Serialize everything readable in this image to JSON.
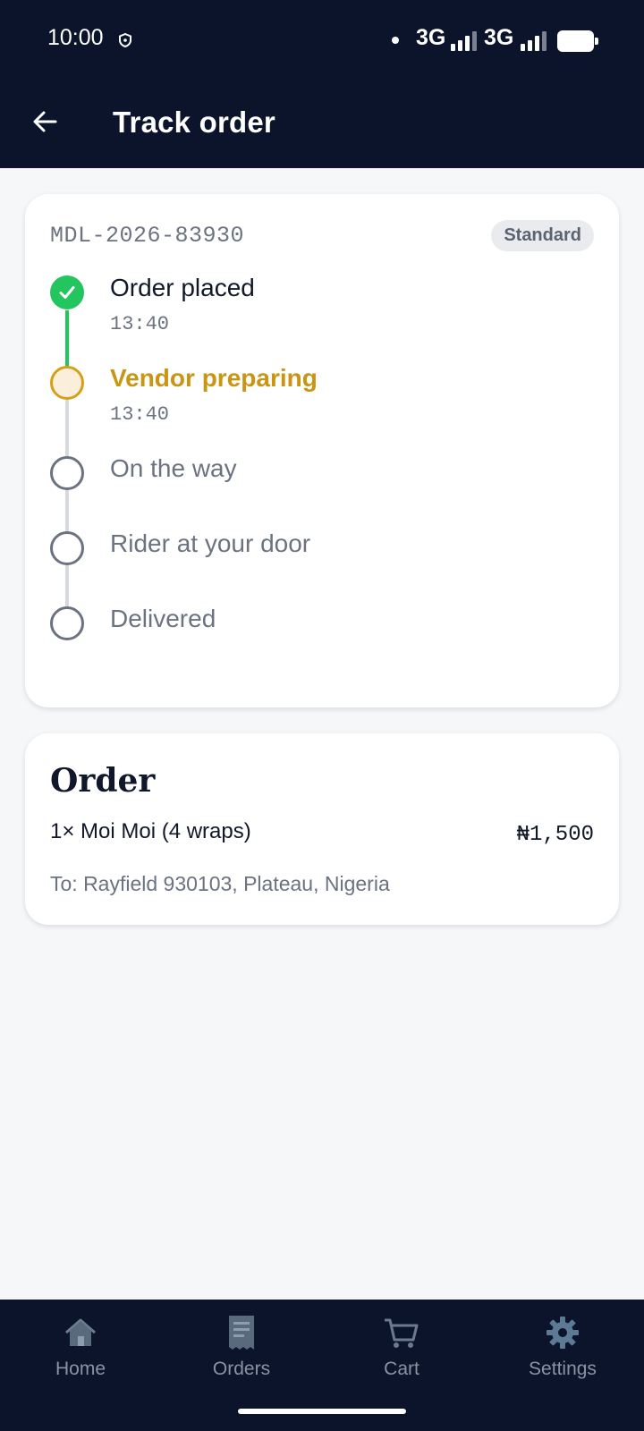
{
  "status_bar": {
    "time": "10:00",
    "network_1": "3G",
    "network_2": "3G",
    "icons": [
      "shield-icon",
      "dot-icon",
      "signal-icon",
      "signal-icon",
      "battery-icon"
    ]
  },
  "app_bar": {
    "title": "Track order",
    "back_icon": "arrow-left-icon"
  },
  "tracking": {
    "order_id": "MDL-2026-83930",
    "tier": "Standard",
    "steps": [
      {
        "label": "Order placed",
        "time": "13:40",
        "state": "done"
      },
      {
        "label": "Vendor preparing",
        "time": "13:40",
        "state": "active"
      },
      {
        "label": "On the way",
        "state": "todo"
      },
      {
        "label": "Rider at your door",
        "state": "todo"
      },
      {
        "label": "Delivered",
        "state": "todo"
      }
    ]
  },
  "order": {
    "heading": "Order",
    "item": "1× Moi Moi (4 wraps)",
    "price": "₦1,500",
    "address": "To: Rayfield 930103, Plateau, Nigeria"
  },
  "bottom_nav": {
    "items": [
      {
        "label": "Home",
        "icon": "home-icon"
      },
      {
        "label": "Orders",
        "icon": "receipt-icon"
      },
      {
        "label": "Cart",
        "icon": "cart-icon"
      },
      {
        "label": "Settings",
        "icon": "gear-icon"
      }
    ]
  },
  "colors": {
    "header_bg": "#0b142a",
    "success": "#22c55e",
    "active": "#d4a017",
    "muted": "#6b7280"
  }
}
